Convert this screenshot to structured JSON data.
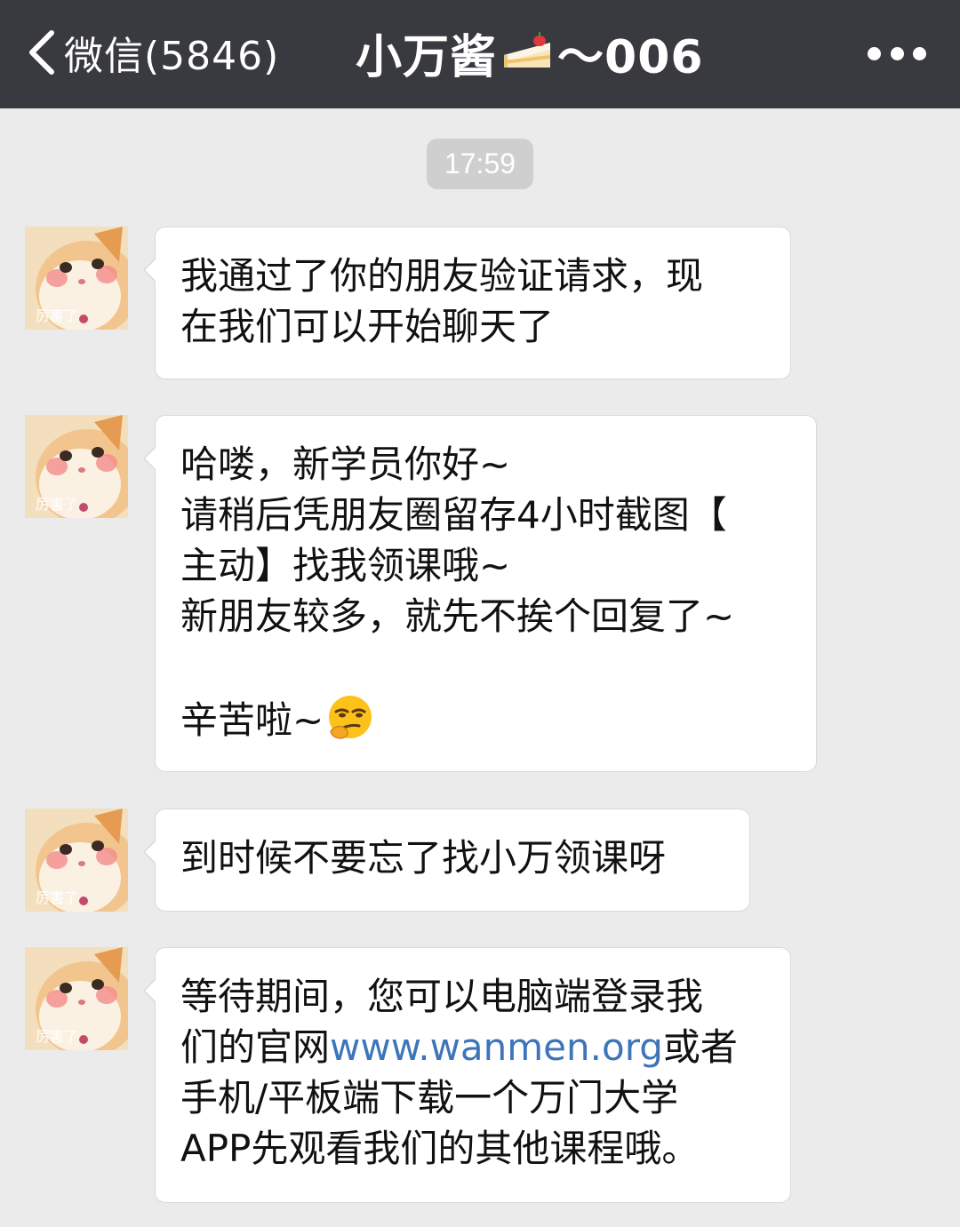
{
  "header": {
    "back_label": "微信(5846)",
    "title_name": "小万酱",
    "title_suffix": "～006",
    "more_icon": "more-dots-icon"
  },
  "timestamp": "17:59",
  "messages": [
    {
      "text": "我通过了你的朋友验证请求，现\n在我们可以开始聊天了"
    },
    {
      "text": "哈喽，新学员你好~\n请稍后凭朋友圈留存4小时截图【\n主动】找我领课哦~\n新朋友较多，就先不挨个回复了~\n\n辛苦啦~",
      "emoji": "smirk-emoji"
    },
    {
      "text": "到时候不要忘了找小万领课呀"
    },
    {
      "before_link": "等待期间，您可以电脑端登录我\n们的官网",
      "link": "www.wanmen.org",
      "after_link": "或者\n手机/平板端下载一个万门大学\nAPP先观看我们的其他课程哦。"
    }
  ],
  "avatar": {
    "caption": "厉害了",
    "description": "cat-avatar"
  },
  "colors": {
    "header_bg": "#393a3f",
    "chat_bg": "#ebebeb",
    "bubble_bg": "#ffffff",
    "link": "#3d75b9",
    "timestamp_bg": "#cfcfcf"
  }
}
